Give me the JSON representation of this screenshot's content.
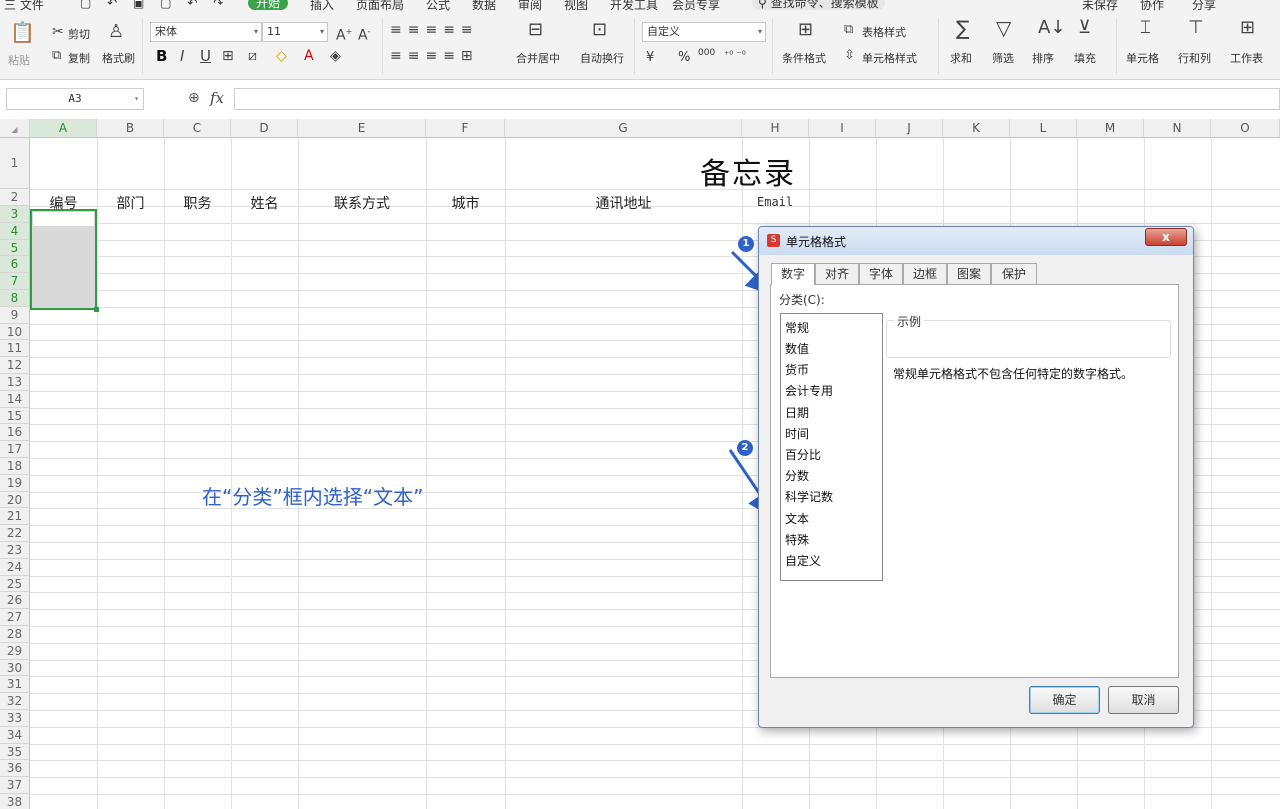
{
  "menubar": {
    "file": "三 文件",
    "start": "开始",
    "insert": "插入",
    "page_layout": "页面布局",
    "formula": "公式",
    "data": "数据",
    "review": "审阅",
    "view": "视图",
    "dev": "开发工具",
    "member": "会员专享",
    "search": "查找命令、搜索模板",
    "unsaved": "未保存",
    "collab": "协作",
    "share": "分享"
  },
  "ribbon": {
    "paste": "粘贴",
    "cut": "剪切",
    "copy": "复制",
    "format_painter": "格式刷",
    "font_name": "宋体",
    "font_size": "11",
    "bold": "B",
    "italic": "I",
    "underline": "U",
    "merge_center": "合并居中",
    "wrap": "自动换行",
    "num_format": "自定义",
    "currency": "¥",
    "percent": "%",
    "thousands": "000",
    "cond_format": "条件格式",
    "table_style": "表格样式",
    "cell_style": "单元格样式",
    "sum": "求和",
    "filter": "筛选",
    "sort": "排序",
    "fill": "填充",
    "cell": "单元格",
    "rowcol": "行和列",
    "sheet": "工作表"
  },
  "formula_bar": {
    "name_box": "A3",
    "fx": "fx"
  },
  "columns": [
    "A",
    "B",
    "C",
    "D",
    "E",
    "F",
    "G",
    "H",
    "I",
    "J",
    "K",
    "L",
    "M",
    "N",
    "O"
  ],
  "rows": [
    "1",
    "2",
    "3",
    "4",
    "5",
    "6",
    "7",
    "8",
    "9",
    "10",
    "11",
    "12",
    "13",
    "14",
    "15",
    "16",
    "17",
    "18",
    "19",
    "20",
    "21",
    "22",
    "23",
    "24",
    "25",
    "26",
    "27",
    "28",
    "29",
    "30",
    "31",
    "32",
    "33",
    "34",
    "35",
    "36",
    "37",
    "38"
  ],
  "sheet": {
    "title": "备忘录",
    "headers": [
      "编号",
      "部门",
      "职务",
      "姓名",
      "联系方式",
      "城市",
      "通讯地址"
    ],
    "email": "Email"
  },
  "annotation": "在“分类”框内选择“文本”",
  "dialog": {
    "title": "单元格格式",
    "logo": "S",
    "close": "x",
    "tabs": [
      "数字",
      "对齐",
      "字体",
      "边框",
      "图案",
      "保护"
    ],
    "category_label": "分类(C):",
    "categories": [
      "常规",
      "数值",
      "货币",
      "会计专用",
      "日期",
      "时间",
      "百分比",
      "分数",
      "科学记数",
      "文本",
      "特殊",
      "自定义"
    ],
    "sample_label": "示例",
    "description": "常规单元格格式不包含任何特定的数字格式。",
    "ok": "确定",
    "cancel": "取消"
  },
  "badges": [
    "1",
    "2"
  ]
}
